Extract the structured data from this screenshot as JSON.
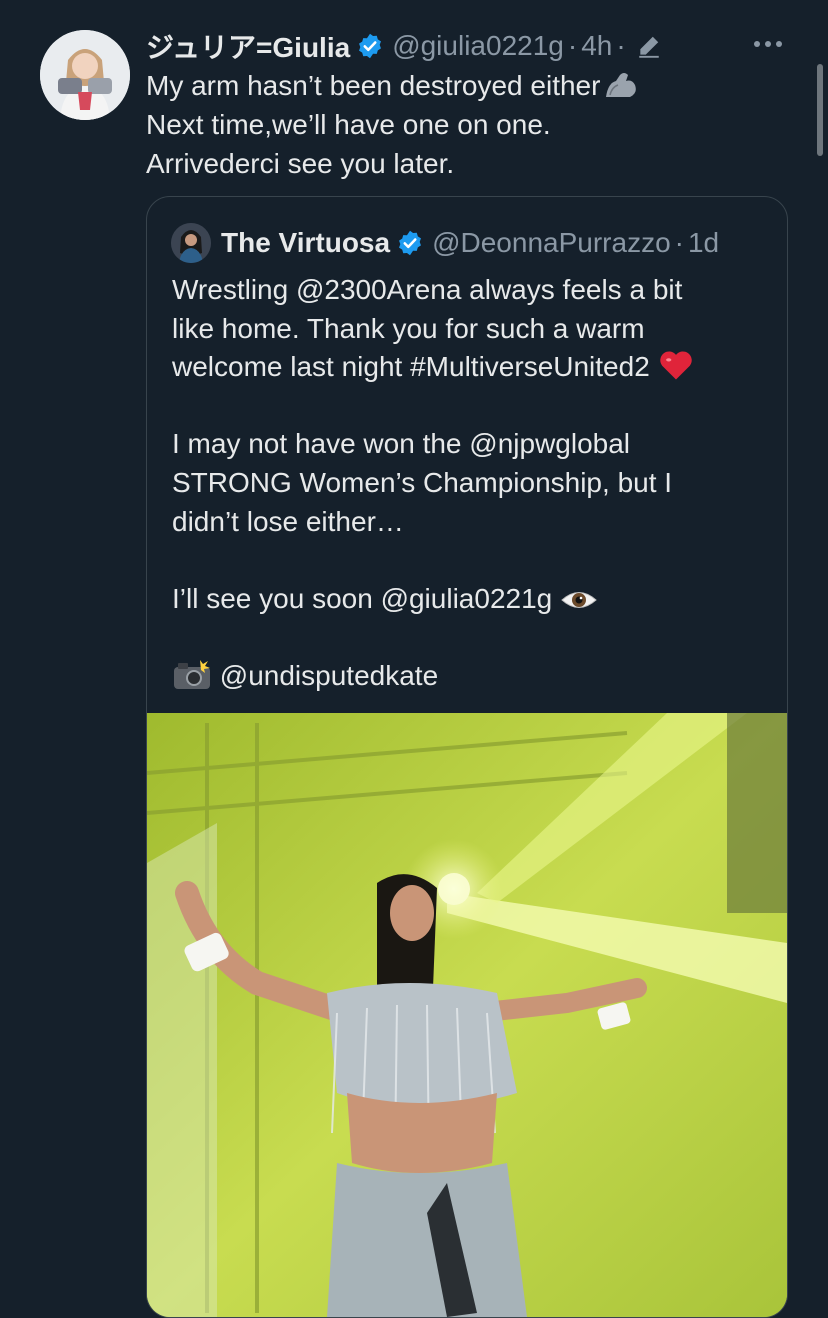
{
  "tweet": {
    "display_name": "ジュリア=Giulia",
    "handle": "@giulia0221g",
    "separator": "·",
    "time": "4h",
    "lines": [
      "My arm hasn’t been destroyed either",
      "Next time,we’ll have one on one.",
      "Arrivederci see you later."
    ]
  },
  "quoted": {
    "display_name": "The Virtuosa",
    "handle": "@DeonnaPurrazzo",
    "separator": "·",
    "time": "1d",
    "paragraph1": [
      "Wrestling @2300Arena always feels a bit",
      "like home. Thank you for such a warm",
      "welcome last night #MultiverseUnited2"
    ],
    "paragraph2": [
      "I may not have won the @njpwglobal",
      "STRONG Women’s Championship, but I",
      "didn’t lose either…"
    ],
    "paragraph3": "I’ll see you soon @giulia0221g",
    "paragraph4": "@undisputedkate"
  },
  "icons": {
    "verified": "verified-badge-icon",
    "edit": "edit-pencil-icon",
    "more": "more-options-icon",
    "arm": "flexed-arm-emoji",
    "heart": "red-heart-emoji",
    "eye": "eye-emoji",
    "camera": "camera-flash-emoji"
  },
  "colors": {
    "background": "#15202b",
    "text": "#e7e9ea",
    "muted": "#8b98a5",
    "verified_blue": "#1d9bf0",
    "border": "#38444d"
  }
}
